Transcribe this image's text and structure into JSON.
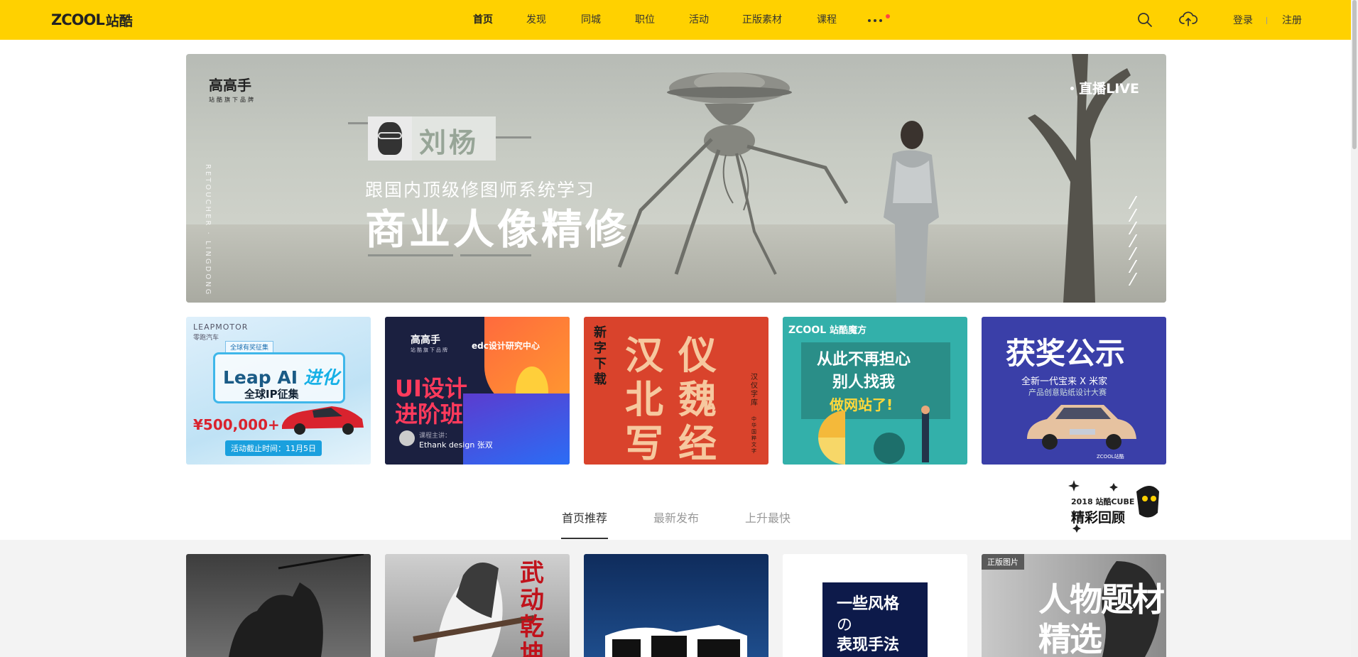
{
  "nav": {
    "logo_en": "ZCOOL",
    "logo_cn": "站酷",
    "items": [
      {
        "label": "首页",
        "active": true
      },
      {
        "label": "发现",
        "active": false
      },
      {
        "label": "同城",
        "active": false
      },
      {
        "label": "职位",
        "active": false
      },
      {
        "label": "活动",
        "active": false
      },
      {
        "label": "正版素材",
        "active": false
      },
      {
        "label": "课程",
        "active": false
      }
    ],
    "more_icon": "more-dots-icon",
    "search_icon": "search-icon",
    "upload_icon": "upload-icon",
    "login": "登录",
    "register": "注册",
    "accent_color": "#ffd100"
  },
  "hero": {
    "brand": "高高手",
    "brand_sub": "站酷旗下品牌",
    "vertical_text": "RETOUCHER · LINGDONG",
    "name": "刘杨",
    "subtitle": "跟国内顶级修图师系统学习",
    "title": "商业人像精修",
    "live": "直播LIVE"
  },
  "promos": [
    {
      "brand": "LEAPMOTOR",
      "brand_cn": "零跑汽车",
      "tag": "全球有奖征集",
      "headline_a": "Leap AI ",
      "headline_b": "进化",
      "sub": "全球IP征集",
      "prize": "¥500,000+",
      "deadline": "活动截止时间：11月5日"
    },
    {
      "brand": "高高手",
      "brand_sub": "站酷旗下品牌",
      "partner": "edc设计研究中心",
      "line1": "UI设计",
      "line2": "进阶班",
      "teacher_label": "课程主讲：",
      "teacher": "Ethank design 张双"
    },
    {
      "side": "新字下载",
      "chars": [
        "汉",
        "仪",
        "北",
        "魏",
        "写",
        "经"
      ],
      "right": "汉仪字库",
      "right2": "中华国粹文字"
    },
    {
      "brand_en": "ZCOOL",
      "brand_cn": "站酷魔方",
      "line1": "从此不再担心",
      "line2": "别人找我",
      "line3": "做网站了!"
    },
    {
      "title": "获奖公示",
      "sub1": "全新一代宝来 X 米家",
      "sub2": "产品创意贴纸设计大赛",
      "footer": "ZCOOL站酷"
    }
  ],
  "tabs": [
    {
      "label": "首页推荐",
      "active": true
    },
    {
      "label": "最新发布",
      "active": false
    },
    {
      "label": "上升最快",
      "active": false
    }
  ],
  "cube": {
    "line1": "2018 站酷CUBE",
    "line2": "精彩回顾"
  },
  "works": [
    {
      "kind": "image"
    },
    {
      "kind": "image",
      "art_text": "武动乾坤"
    },
    {
      "kind": "image"
    },
    {
      "kind": "text",
      "line1": "一些风格",
      "line2": "の",
      "line3": "表现手法"
    },
    {
      "kind": "image",
      "badge": "正版图片",
      "art_line1": "人物题材",
      "art_line2": "精选"
    }
  ]
}
